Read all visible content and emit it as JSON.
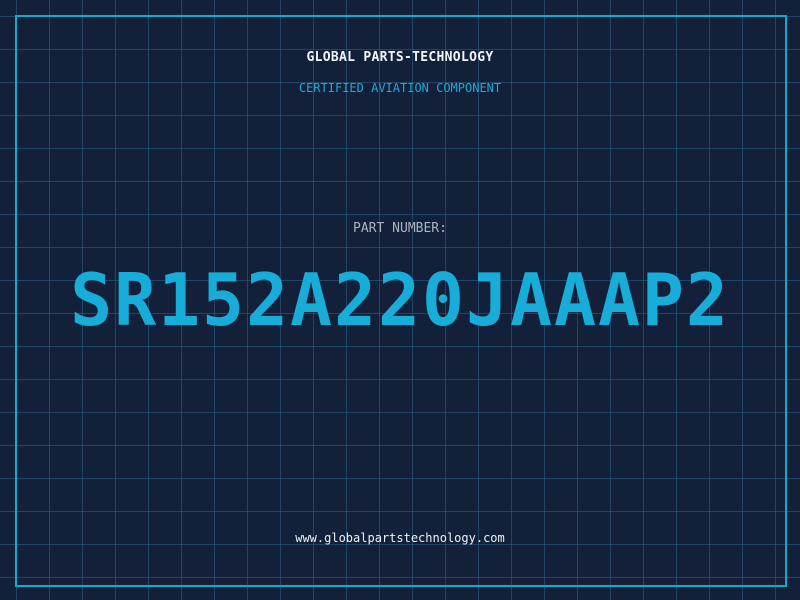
{
  "header": {
    "company_name": "GLOBAL PARTS-TECHNOLOGY",
    "subtitle": "CERTIFIED AVIATION COMPONENT"
  },
  "part": {
    "label": "PART NUMBER:",
    "number": "SR152A220JAAAP2"
  },
  "footer": {
    "website": "www.globalpartstechnology.com"
  },
  "colors": {
    "background": "#13203a",
    "grid": "#28648c",
    "accent": "#18acd8",
    "frame": "#1aa7cc"
  }
}
